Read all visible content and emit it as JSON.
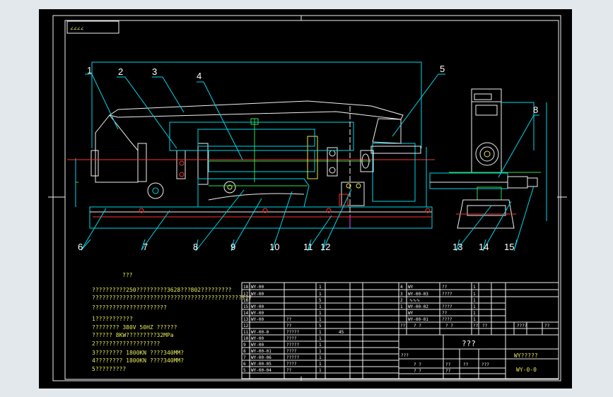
{
  "corner_marks": "∠∠∠∠",
  "balloons": [
    {
      "id": "1",
      "label": "1"
    },
    {
      "id": "2",
      "label": "2"
    },
    {
      "id": "3",
      "label": "3"
    },
    {
      "id": "4",
      "label": "4"
    },
    {
      "id": "5",
      "label": "5"
    },
    {
      "id": "6",
      "label": "6"
    },
    {
      "id": "7",
      "label": "7"
    },
    {
      "id": "8a",
      "label": "8"
    },
    {
      "id": "8b",
      "label": "8"
    },
    {
      "id": "9",
      "label": "9"
    },
    {
      "id": "10",
      "label": "10"
    },
    {
      "id": "11",
      "label": "11"
    },
    {
      "id": "12",
      "label": "12"
    },
    {
      "id": "13",
      "label": "13"
    },
    {
      "id": "14",
      "label": "14"
    },
    {
      "id": "15",
      "label": "15"
    }
  ],
  "notes": {
    "heading": "???",
    "lines": [
      "??????????250?????????3628???802?????????",
      "???????????????????????????????????????????????",
      "??????????????????????",
      "1???????????",
      "   ????????     380V    50HZ     ??????",
      "   ??????    8KW?????????32MPa",
      "2???????????????????",
      "3????????      1800KN       ????340MM?",
      "4????????      1800KN       ????340MM?",
      "5?????????"
    ]
  },
  "bom_left": [
    {
      "no": "18",
      "code": "WY-00",
      "qty": "1"
    },
    {
      "no": "17",
      "code": "WY-00",
      "qty": "1"
    },
    {
      "no": "16",
      "code": "",
      "qty": "5"
    },
    {
      "no": "15",
      "code": "WY-00",
      "qty": "1"
    },
    {
      "no": "14",
      "code": "WY-00",
      "qty": "1"
    },
    {
      "no": "13",
      "code": "WY-00",
      "name": "??",
      "qty": "1"
    },
    {
      "no": "12",
      "code": "",
      "name": "??",
      "qty": "5"
    },
    {
      "no": "11",
      "code": "WY-00-0",
      "name": "?????",
      "qty": "1",
      "mat": "45"
    },
    {
      "no": "10",
      "code": "WY-00",
      "name": "????",
      "qty": "1"
    },
    {
      "no": "9",
      "code": "WY-00",
      "name": "?????",
      "qty": "1"
    },
    {
      "no": "8",
      "code": "WY-00-01",
      "name": "????",
      "qty": "1"
    },
    {
      "no": "7",
      "code": "WY-00-06",
      "name": "?????",
      "qty": "1"
    },
    {
      "no": "6",
      "code": "WY-00-05",
      "name": "????",
      "qty": "1"
    },
    {
      "no": "5",
      "code": "WY-00-04",
      "name": "??",
      "qty": "1"
    }
  ],
  "bom_right": [
    {
      "no": "4",
      "code": "WY",
      "name": "??",
      "qty": "1"
    },
    {
      "no": "3",
      "code": "WY-00-03",
      "name": "????",
      "qty": "1"
    },
    {
      "no": "2",
      "code": "",
      "name": "∿∿∿",
      "qty": "1"
    },
    {
      "no": "1",
      "code": "WY-00-02",
      "name": "????",
      "qty": "1"
    },
    {
      "no": "",
      "code": "WY",
      "name": "??",
      "qty": "1"
    },
    {
      "no": "",
      "code": "WY-00-01",
      "name": "????",
      "qty": "1"
    }
  ],
  "bom_header": [
    "??",
    "?  ?",
    "?  ?",
    "??",
    "??",
    "????",
    "??"
  ],
  "title_block": {
    "name": "???",
    "project": "WY?????",
    "drawing_no": "WY-0-0",
    "marks": [
      "???",
      "?  ?",
      "??",
      "??",
      "???",
      "?  ?",
      "??"
    ]
  }
}
